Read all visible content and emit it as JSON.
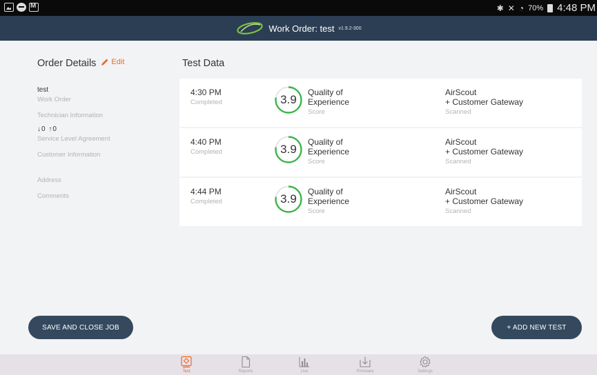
{
  "status_bar": {
    "battery": "70%",
    "clock": "4:48 PM"
  },
  "title_bar": {
    "title": "Work Order: test",
    "version": "v1.9.2-300"
  },
  "order_details": {
    "heading": "Order Details",
    "edit_label": "Edit",
    "work_order_value": "test",
    "work_order_label": "Work Order",
    "technician_label": "Technician Information",
    "sla_value": "↓0 ↑0",
    "sla_label": "Service Level Agreement",
    "customer_label": "Customer Information",
    "address_label": "Address",
    "comments_label": "Comments"
  },
  "test_data": {
    "heading": "Test Data",
    "tests": [
      {
        "time": "4:30 PM",
        "status": "Completed",
        "score": "3.9",
        "metric_line1": "Quality of",
        "metric_line2": "Experience",
        "metric_sub": "Score",
        "device_line1": "AirScout",
        "device_line2": "+ Customer Gateway",
        "device_sub": "Scanned"
      },
      {
        "time": "4:40 PM",
        "status": "Completed",
        "score": "3.9",
        "metric_line1": "Quality of",
        "metric_line2": "Experience",
        "metric_sub": "Score",
        "device_line1": "AirScout",
        "device_line2": "+ Customer Gateway",
        "device_sub": "Scanned"
      },
      {
        "time": "4:44 PM",
        "status": "Completed",
        "score": "3.9",
        "metric_line1": "Quality of",
        "metric_line2": "Experience",
        "metric_sub": "Score",
        "device_line1": "AirScout",
        "device_line2": "+ Customer Gateway",
        "device_sub": "Scanned"
      }
    ]
  },
  "actions": {
    "save_label": "SAVE AND CLOSE JOB",
    "add_label": "+ ADD NEW TEST"
  },
  "bottom_nav": {
    "items": [
      {
        "label": "Test",
        "icon": "test-icon"
      },
      {
        "label": "Reports",
        "icon": "reports-icon"
      },
      {
        "label": "Live",
        "icon": "live-icon"
      },
      {
        "label": "Firmware",
        "icon": "firmware-icon"
      },
      {
        "label": "Settings",
        "icon": "gear-icon"
      }
    ]
  },
  "colors": {
    "accent": "#ef6a2a",
    "header": "#2c3e54",
    "button": "#34495e",
    "score_ring": "#3cb54a"
  }
}
